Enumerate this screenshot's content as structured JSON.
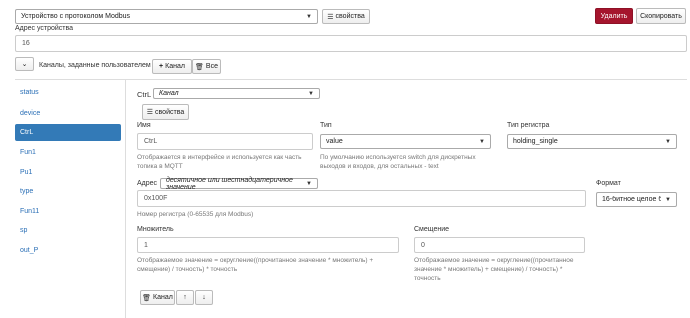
{
  "device": {
    "protocol_select": "Устройство с протоколом Modbus",
    "properties_button": "свойства",
    "delete_button": "Удалить",
    "copy_button": "Скопировать",
    "address_label": "Адрес устройства",
    "address_value": "16"
  },
  "channels_bar": {
    "title": "Каналы, заданные пользователем",
    "add_channel_button": "Канал",
    "all_button": "Все"
  },
  "sidebar": {
    "items": [
      {
        "label": "status"
      },
      {
        "label": "device"
      },
      {
        "label": "CtrL"
      },
      {
        "label": "Fun1"
      },
      {
        "label": "Pu1"
      },
      {
        "label": "type"
      },
      {
        "label": "Fun11"
      },
      {
        "label": "sp"
      },
      {
        "label": "out_P"
      }
    ],
    "active_index": 2
  },
  "channel": {
    "name_prefix": "CtrL",
    "kind_select": "Канал",
    "properties_button": "свойства",
    "name_label": "Имя",
    "name_value": "CtrL",
    "name_help": "Отображается в интерфейсе и используется как часть топика в MQTT",
    "type_label": "Тип",
    "type_value": "value",
    "type_help": "По умолчанию используется switch для дискретных выходов и входов, для остальных - text",
    "reg_type_label": "Тип регистра",
    "reg_type_value": "holding_single",
    "address_label": "Адрес",
    "address_format_select": "десятичное или шестнадцатеричное значение",
    "address_value": "0x100F",
    "address_help": "Номер регистра (0-65535 для Modbus)",
    "format_label": "Формат",
    "format_value": "16-битное целое б",
    "multiplier_label": "Множитель",
    "multiplier_value": "1",
    "multiplier_help": "Отображаемое значение = округление((прочитанное значение * множитель) + смещение) / точность) * точность",
    "offset_label": "Смещение",
    "offset_value": "0",
    "offset_help": "Отображаемое значение = округление((прочитанное значение * множитель) + смещение) / точность) * точность",
    "delete_channel_button": "Канал"
  },
  "colors": {
    "danger": "#a5152d",
    "primary": "#337ab7"
  }
}
